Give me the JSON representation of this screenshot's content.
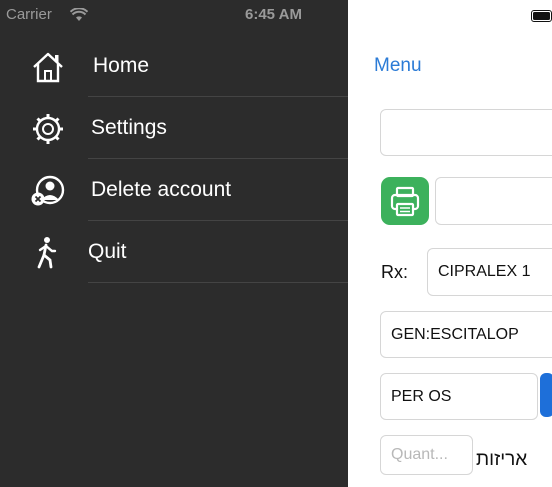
{
  "status": {
    "carrier": "Carrier",
    "time": "6:45 AM"
  },
  "drawer": {
    "items": [
      {
        "label": "Home",
        "icon": "home-icon"
      },
      {
        "label": "Settings",
        "icon": "gear-icon"
      },
      {
        "label": "Delete account",
        "icon": "delete-account-icon"
      },
      {
        "label": "Quit",
        "icon": "walking-person-icon"
      }
    ]
  },
  "main": {
    "menu_label": "Menu",
    "top_field_value": "",
    "print_field_value": "",
    "rx_label": "Rx:",
    "rx_value": "CIPRALEX 1",
    "generic_value": "GEN:ESCITALOP",
    "route_value": "PER OS",
    "quantity_placeholder": "Quant...",
    "package_unit_label": "אריזות"
  },
  "colors": {
    "drawer_bg": "#2c2c2c",
    "accent_blue": "#2b7bd6",
    "print_green": "#3cb15c"
  }
}
